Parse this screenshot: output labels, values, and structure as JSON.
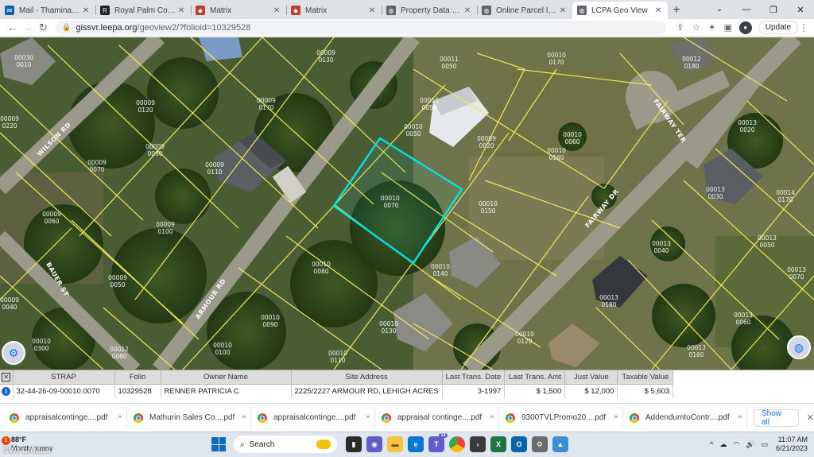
{
  "browser": {
    "tabs": [
      {
        "title": "Mail - Thamina Qureshi",
        "favicon_color": "#0a64ad",
        "favicon_glyph": "mail-icon"
      },
      {
        "title": "Royal Palm Coast REALTOR",
        "favicon_color": "#202124",
        "favicon_glyph": "realtor-icon"
      },
      {
        "title": "Matrix",
        "favicon_color": "#c0392b",
        "favicon_glyph": "matrix-icon"
      },
      {
        "title": "Matrix",
        "favicon_color": "#c0392b",
        "favicon_glyph": "matrix-icon"
      },
      {
        "title": "Property Data Search",
        "favicon_color": "#5f6368",
        "favicon_glyph": "globe-icon"
      },
      {
        "title": "Online Parcel Inquiry",
        "favicon_color": "#5f6368",
        "favicon_glyph": "globe-icon"
      },
      {
        "title": "LCPA Geo View",
        "favicon_color": "#5f6368",
        "favicon_glyph": "globe-icon",
        "active": true
      }
    ],
    "url_host": "gissvr.leepa.org",
    "url_path": "/geoview2/?folioid=10329528",
    "update_label": "Update"
  },
  "map": {
    "roads": [
      "WILSON RD",
      "ARMOUR RD",
      "FAIRWAY TER",
      "FAIRWAY DR",
      "BAUER ST"
    ],
    "parcel_labels": [
      "00030\n0010",
      "00011\n0050",
      "00009\n0130",
      "00010\n0050",
      "00010\n0170",
      "00012\n0180",
      "00009\n0220",
      "00010\n0050",
      "00009\n0120",
      "00009\n0170",
      "00010\n0060",
      "00010\n0160",
      "00013\n0020",
      "00009\n0110",
      "00009\n0070",
      "00010\n0070",
      "00010\n0150",
      "00013\n0030",
      "00009\n0060",
      "00009\n0100",
      "00009\n0090",
      "00010\n0080",
      "00010\n0140",
      "00013\n0040",
      "00009\n0050",
      "00010\n0090",
      "00010\n0130",
      "00013\n0050",
      "00013\n0070",
      "00009\n0040",
      "00010\n0100",
      "00010\n0110",
      "00013\n0060",
      "00012\n0080",
      "00010\n0120",
      "00013\n0160",
      "00010\n0300",
      "00009\n0020",
      "00013\n0180",
      "00014\n0170"
    ],
    "selected_parcel": "00010\n0070",
    "colors": {
      "parcel_line": "#f3e85a",
      "selected_outline": "#00e5e5"
    }
  },
  "attributes": {
    "columns": [
      "STRAP",
      "Folio",
      "Owner Name",
      "Site Address",
      "Last Trans. Date",
      "Last Trans. Amt",
      "Just Value",
      "Taxable Value"
    ],
    "row": {
      "strap": "32-44-26-09-00010.0070",
      "folio": "10329528",
      "owner": "RENNER PATRICIA C",
      "address": "2225/2227 ARMOUR RD, LEHIGH ACRES",
      "last_date": "3-1997",
      "last_amt": "$ 1,500",
      "just_value": "$ 12,000",
      "taxable_value": "$ 5,603"
    }
  },
  "downloads": {
    "items": [
      "appraisalcontinge....pdf",
      "Mathurin Sales Co....pdf",
      "appraisalcontinge....pdf",
      "appraisal continge....pdf",
      "9300TVLPromo20....pdf",
      "AddendumtoContr....pdf"
    ],
    "show_all": "Show all"
  },
  "taskbar": {
    "weather_temp": "88°F",
    "weather_desc": "Mostly sunny",
    "weather_badge": "1",
    "search_label": "Search",
    "teams_count": "31",
    "time": "11:07 AM",
    "date": "6/21/2023"
  },
  "watermark": "SWFLAMLS"
}
